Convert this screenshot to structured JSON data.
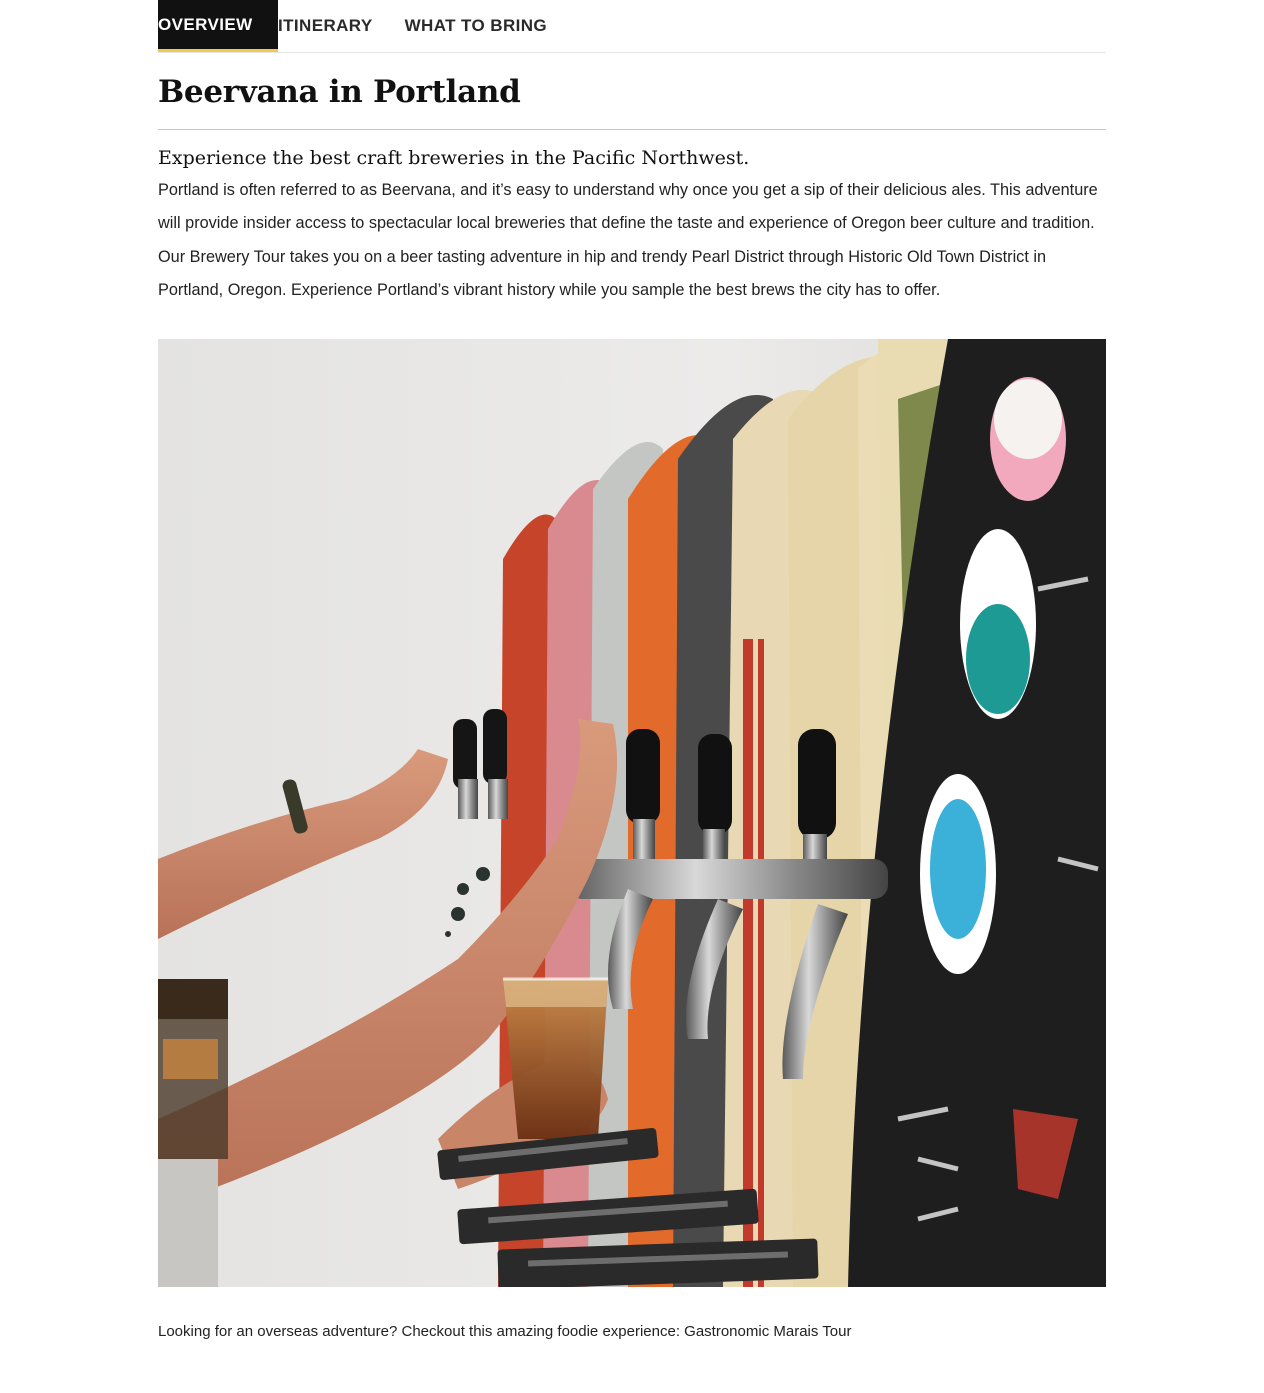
{
  "tabs": [
    {
      "label": "OVERVIEW",
      "active": true
    },
    {
      "label": "ITINERARY",
      "active": false
    },
    {
      "label": "WHAT TO BRING",
      "active": false
    }
  ],
  "title": "Beervana in Portland",
  "subtitle": "Experience the best craft breweries in the Pacific Northwest.",
  "body": "Portland is often referred to as Beervana, and it’s easy to understand why once you get a sip of their delicious ales. This adventure will provide insider access to spectacular local breweries that define the taste and experience of Oregon beer culture and tradition. Our Brewery Tour takes you on a beer tasting adventure in hip and trendy Pearl District through Historic Old Town District in Portland, Oregon. Experience Portland’s vibrant history while you sample the best brews the city has to offer.",
  "caption": {
    "prefix": "Looking for an overseas adventure? Checkout this amazing foodie experience: ",
    "link_label": "Gastronomic Marais Tour"
  },
  "colors": {
    "accent": "#f2c94c",
    "active_tab_bg": "#111111"
  }
}
